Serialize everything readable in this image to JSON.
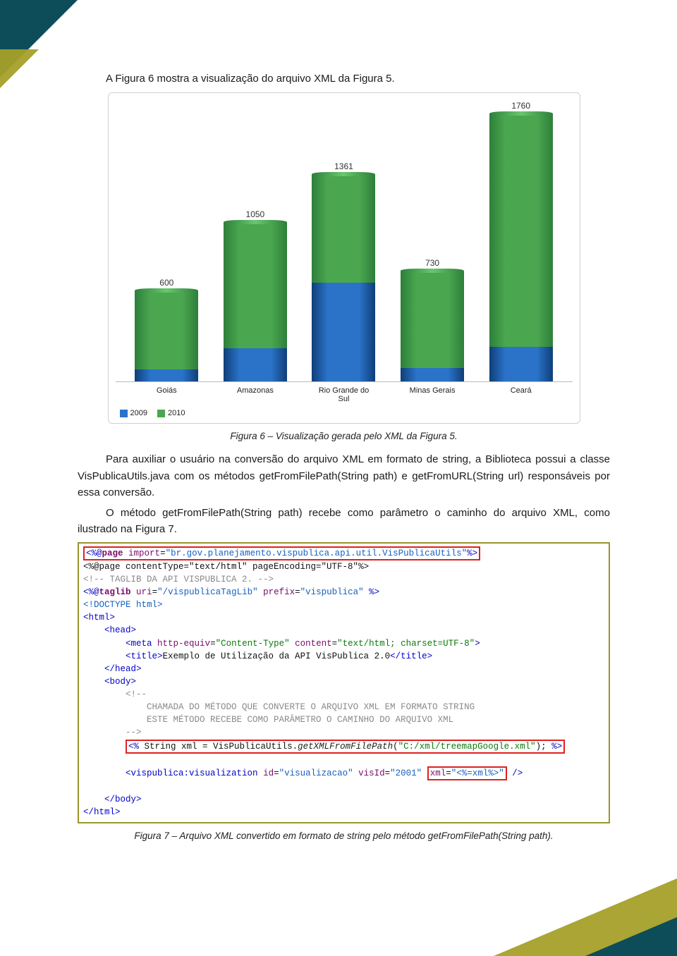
{
  "intro": "A Figura 6 mostra a visualização do arquivo XML da Figura 5.",
  "caption6": "Figura 6 – Visualização gerada pelo XML da Figura 5.",
  "para2": "Para auxiliar o usuário na conversão do arquivo XML em formato de string, a Biblioteca possui a classe VisPublicaUtils.java com os métodos getFromFilePath(String path) e getFromURL(String url) responsáveis por essa conversão.",
  "para3": "O método getFromFilePath(String path) recebe como parâmetro o caminho do arquivo XML, como ilustrado na Figura 7.",
  "caption7": "Figura 7 – Arquivo XML convertido em formato de string pelo método getFromFilePath(String path).",
  "chart_data": {
    "type": "bar",
    "stacked": true,
    "categories": [
      "Goiás",
      "Amazonas",
      "Rio Grande do Sul",
      "Minas Gerais",
      "Ceará"
    ],
    "series": [
      {
        "name": "2009",
        "color": "#2a73c9",
        "values": [
          80,
          220,
          650,
          90,
          230
        ]
      },
      {
        "name": "2010",
        "color": "#4aa74f",
        "values": [
          520,
          830,
          711,
          640,
          1530
        ]
      }
    ],
    "totals": [
      600,
      1050,
      1361,
      730,
      1760
    ],
    "ylim": [
      0,
      1760
    ],
    "legend": [
      "2009",
      "2010"
    ]
  },
  "code": {
    "l1_a": "<%@",
    "l1_b": "page",
    "l1_c": "import",
    "l1_d": "\"br.gov.planejamento.vispublica.api.util.VisPublicaUtils\"",
    "l1_e": "%>",
    "l2": "<%@page contentType=\"text/html\" pageEncoding=\"UTF-8\"%>",
    "l3": "<!-- TAGLIB DA API VISPUBLICA 2. -->",
    "l4_a": "<%@",
    "l4_b": "taglib",
    "l4_c": "uri",
    "l4_d": "\"/vispublicaTagLib\"",
    "l4_e": "prefix",
    "l4_f": "\"vispublica\"",
    "l4_g": " %>",
    "l5": "<!DOCTYPE html>",
    "l6": "<html>",
    "l7": "<head>",
    "l8_a": "<meta",
    "l8_b": "http-equiv",
    "l8_c": "\"Content-Type\"",
    "l8_d": "content",
    "l8_e": "\"text/html; charset=UTF-8\"",
    "l8_f": ">",
    "l9_a": "<title>",
    "l9_b": "Exemplo de Utilização da API VisPublica 2.0",
    "l9_c": "</title>",
    "l10": "</head>",
    "l11": "<body>",
    "l12": "<!--",
    "l13": "CHAMADA DO MÉTODO QUE CONVERTE O ARQUIVO XML EM FORMATO STRING",
    "l14": "ESTE MÉTODO RECEBE COMO PARÂMETRO O CAMINHO DO ARQUIVO XML",
    "l15": "-->",
    "l16_a": "<%",
    "l16_b": " String xml = VisPublicaUtils.",
    "l16_c": "getXMLFromFilePath",
    "l16_d": "(",
    "l16_e": "\"C:/xml/treemapGoogle.xml\"",
    "l16_f": "); ",
    "l16_g": "%>",
    "l18_a": "<vispublica:visualization",
    "l18_b": "id",
    "l18_c": "\"visualizacao\"",
    "l18_d": "visId",
    "l18_e": "\"2001\"",
    "l18_f": "xml",
    "l18_g": "\"<%=xml%>\"",
    "l18_h": "/>",
    "l20": "</body>",
    "l21": "</html>"
  }
}
